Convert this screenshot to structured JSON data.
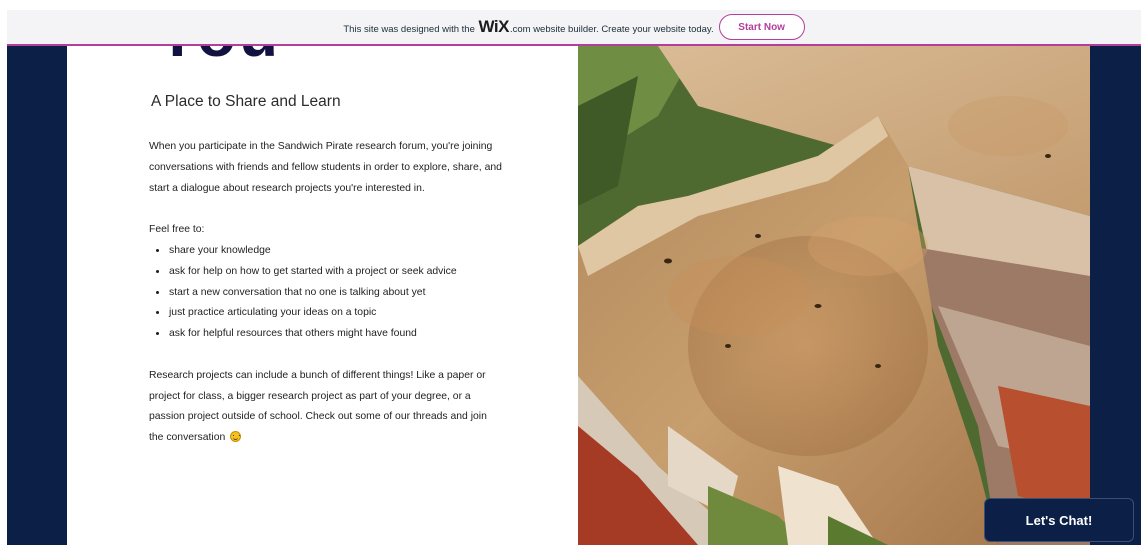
{
  "wix_banner": {
    "text_before": "This site was designed with the",
    "logo": "WiX",
    "text_after": ".com website builder. Create your website today.",
    "button_label": "Start Now"
  },
  "hero": {
    "heading_fragment": "You",
    "subheading": "A Place to Share and Learn"
  },
  "body": {
    "intro": "When you participate in the Sandwich Pirate research forum, you're joining conversations with friends and fellow students in order to explore, share, and start a dialogue about research projects you're interested in.",
    "list_intro": "Feel free to:",
    "list_items": [
      "share your knowledge",
      "ask for help on how to get started with a project or seek advice",
      "start a new conversation that no one is talking about yet",
      "just practice articulating your ideas on a topic",
      "ask for helpful resources that others might have found"
    ],
    "outro": "Research projects can include a bunch of different things! Like a paper or project for class, a bigger research project as part of your degree, or a passion project outside of school. Check out some of our threads and join the conversation",
    "emoji": "smiling-face-emoji"
  },
  "chat": {
    "label": "Let's Chat!"
  },
  "colors": {
    "navy": "#0b1f47",
    "wix_accent": "#b33f9b",
    "banner_bg": "#f4f4f6"
  }
}
